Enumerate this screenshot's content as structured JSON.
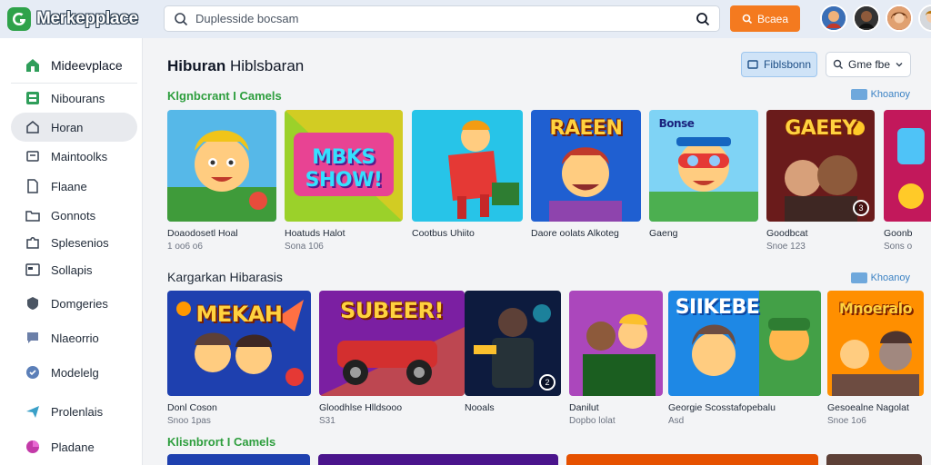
{
  "app": {
    "name": "Merkepplace"
  },
  "search": {
    "placeholder": "Duplesside bocsam"
  },
  "header_button": {
    "label": "Bcaea"
  },
  "avatars": [
    "A",
    "B",
    "C",
    "D"
  ],
  "sidebar": {
    "items": [
      {
        "label": "Mideevplace",
        "icon": "store-icon"
      },
      {
        "label": "Nibourans",
        "icon": "grid-icon"
      },
      {
        "label": "Horan",
        "icon": "home-icon"
      },
      {
        "label": "Maintoolks",
        "icon": "tools-icon"
      },
      {
        "label": "Flaane",
        "icon": "file-icon"
      },
      {
        "label": "Gonnots",
        "icon": "folder-icon"
      },
      {
        "label": "Splesenios",
        "icon": "puzzle-icon"
      },
      {
        "label": "Sollapis",
        "icon": "app-icon"
      },
      {
        "label": "Domgeries",
        "icon": "shield-icon"
      },
      {
        "label": "Nlaeorrio",
        "icon": "chat-icon"
      },
      {
        "label": "Modelelg",
        "icon": "heart-icon"
      },
      {
        "label": "Prolenlais",
        "icon": "send-icon"
      },
      {
        "label": "Pladane",
        "icon": "pie-icon"
      }
    ]
  },
  "page": {
    "title_bold": "Hiburan",
    "title_rest": " Hiblsbaran",
    "filter_label": "Fiblsbonn",
    "sort_label": "Gme fbe"
  },
  "sections": [
    {
      "title": "Klgnbcrant I Camels",
      "see_all": "Khoanoy",
      "cards": [
        {
          "title": "Doaodosetl Hoal",
          "sub": "1 oo6 o6",
          "badge": ""
        },
        {
          "title": "Hoatuds Halot",
          "sub": "Sona 106",
          "badge": "",
          "word": "MBKS SHOW!"
        },
        {
          "title": "Cootbus Uhiito",
          "sub": "",
          "badge": ""
        },
        {
          "title": "Daore oolats Alkoteg",
          "sub": "",
          "badge": "",
          "word": "RAEEN"
        },
        {
          "title": "Gaeng",
          "sub": "",
          "badge": "",
          "word": "Bonse"
        },
        {
          "title": "Goodbcat",
          "sub": "Snoe 123",
          "badge": "3",
          "word": "GAEEY"
        },
        {
          "title": "Goonb",
          "sub": "Sons o",
          "badge": ""
        }
      ]
    },
    {
      "title": "Kargarkan Hibarasis",
      "see_all": "Khoanoy",
      "cards": [
        {
          "title": "Donl Coson",
          "sub": "Snoo 1pas",
          "badge": "",
          "word": "MEKAH"
        },
        {
          "title": "Gloodhlse Hlldsooo",
          "sub": "S31",
          "badge": "",
          "word": "SUBEER!"
        },
        {
          "title": "Nooals",
          "sub": "",
          "badge": "2"
        },
        {
          "title": "Danilut",
          "sub": "Dopbo lolat",
          "badge": ""
        },
        {
          "title": "Georgie Scosstafopebalu",
          "sub": "Asd",
          "badge": "",
          "word": "SIIKEBE"
        },
        {
          "title": "Gesoealne Nagolat",
          "sub": "Snoe 1o6",
          "badge": "",
          "word": "Mnoeralo"
        }
      ]
    },
    {
      "title": "Klisnbrort I Camels",
      "see_all": "",
      "cards": []
    }
  ],
  "colors": {
    "accent_orange": "#f47a1f",
    "brand_green": "#2fa24a",
    "link_blue": "#3b82c4",
    "section_green": "#2e9e3e"
  }
}
